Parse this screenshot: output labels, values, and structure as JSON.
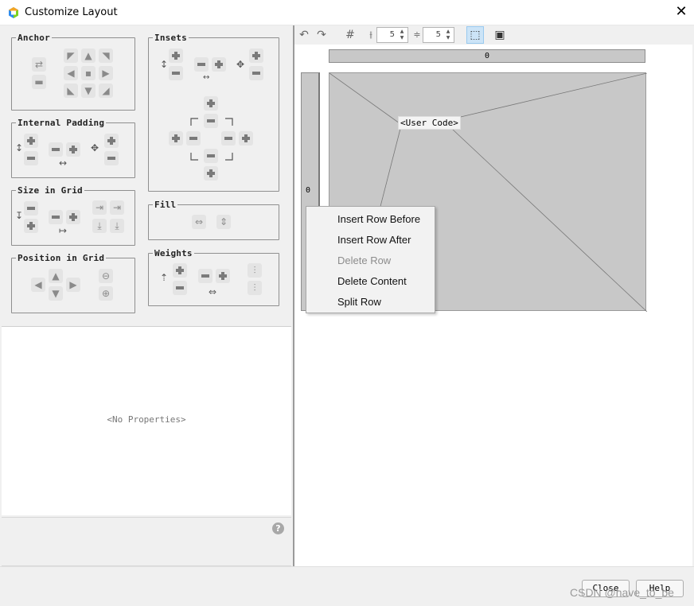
{
  "window": {
    "title": "Customize Layout",
    "close_glyph": "✕"
  },
  "layout_groups": {
    "anchor": "Anchor",
    "internal_padding": "Internal Padding",
    "size_in_grid": "Size in Grid",
    "position_in_grid": "Position in Grid",
    "insets": "Insets",
    "fill": "Fill",
    "weights": "Weights"
  },
  "properties": {
    "empty_text": "<No Properties>",
    "help_glyph": "?"
  },
  "toolbar": {
    "h_gap": "5",
    "v_gap": "5"
  },
  "grid": {
    "column_header": "0",
    "row_header": "0",
    "cell_label": "<User Code>"
  },
  "context_menu": {
    "items": [
      {
        "label": "Insert Row Before",
        "enabled": true
      },
      {
        "label": "Insert Row After",
        "enabled": true
      },
      {
        "label": "Delete Row",
        "enabled": false
      },
      {
        "label": "Delete Content",
        "enabled": true
      },
      {
        "label": "Split Row",
        "enabled": true
      }
    ]
  },
  "buttons": {
    "close": "Close",
    "help": "Help"
  },
  "watermark": "CSDN @have_to_be",
  "colors": {
    "accent_selected": "#cce4f7",
    "grid_fill": "#c8c8c8"
  }
}
